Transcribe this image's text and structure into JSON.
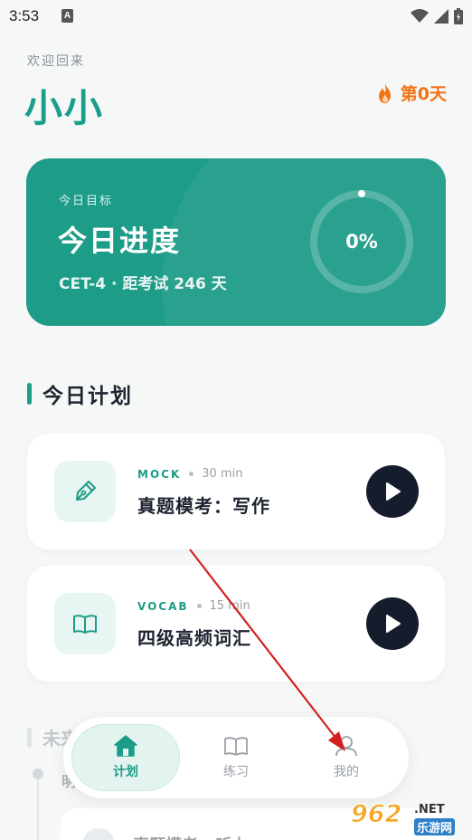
{
  "status_bar": {
    "time": "3:53",
    "notif_badge": "A",
    "icons": [
      "wifi-icon",
      "signal-icon",
      "battery-icon"
    ]
  },
  "header": {
    "welcome": "欢迎回来",
    "username": "小小",
    "streak": "第0天"
  },
  "progress_card": {
    "eyebrow": "今日目标",
    "title": "今日进度",
    "subtitle": "CET-4 · 距考试 246 天",
    "percent_label": "0%",
    "percent_value": 0
  },
  "plan": {
    "section_title": "今日计划",
    "tasks": [
      {
        "tag": "MOCK",
        "duration": "30 min",
        "title": "真题模考：写作",
        "icon": "pen-icon"
      },
      {
        "tag": "VOCAB",
        "duration": "15 min",
        "title": "四级高频词汇",
        "icon": "book-icon"
      }
    ]
  },
  "future": {
    "section_title": "未来",
    "timeline_label": "明",
    "peek_title": "真题模考 · 听力"
  },
  "tabbar": {
    "tabs": [
      {
        "label": "计划",
        "icon": "home-icon",
        "active": true
      },
      {
        "label": "练习",
        "icon": "book-icon",
        "active": false
      },
      {
        "label": "我的",
        "icon": "user-icon",
        "active": false
      }
    ]
  },
  "watermark": {
    "big": "962",
    "net": ".NET",
    "cn": "乐游网"
  },
  "colors": {
    "accent": "#1d9c87",
    "streak": "#f07418",
    "play": "#151c2b",
    "annotation_arrow": "#d32020"
  }
}
